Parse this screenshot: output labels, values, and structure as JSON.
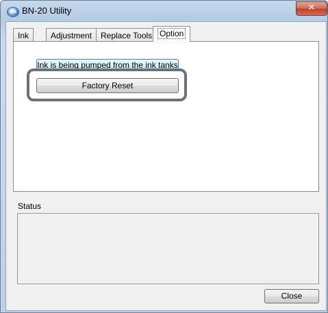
{
  "window": {
    "title": "BN-20 Utility",
    "icon": "app-logo-icon",
    "icon_text": "BN",
    "close_glyph": "✕"
  },
  "tabs": [
    {
      "label": "Ink",
      "active": false
    },
    {
      "label": "Adjustment",
      "active": false
    },
    {
      "label": "Replace Tools",
      "active": false
    },
    {
      "label": "Option",
      "active": true
    }
  ],
  "option_panel": {
    "partially_hidden_button_label": "Ink is being pumped from the ink tanks",
    "factory_reset_label": "Factory Reset"
  },
  "status": {
    "label": "Status",
    "text": ""
  },
  "footer": {
    "close_label": "Close"
  },
  "colors": {
    "highlight_frame": "#707070",
    "titlebar": "#b4cbe4",
    "close_button_red": "#c0412a"
  }
}
